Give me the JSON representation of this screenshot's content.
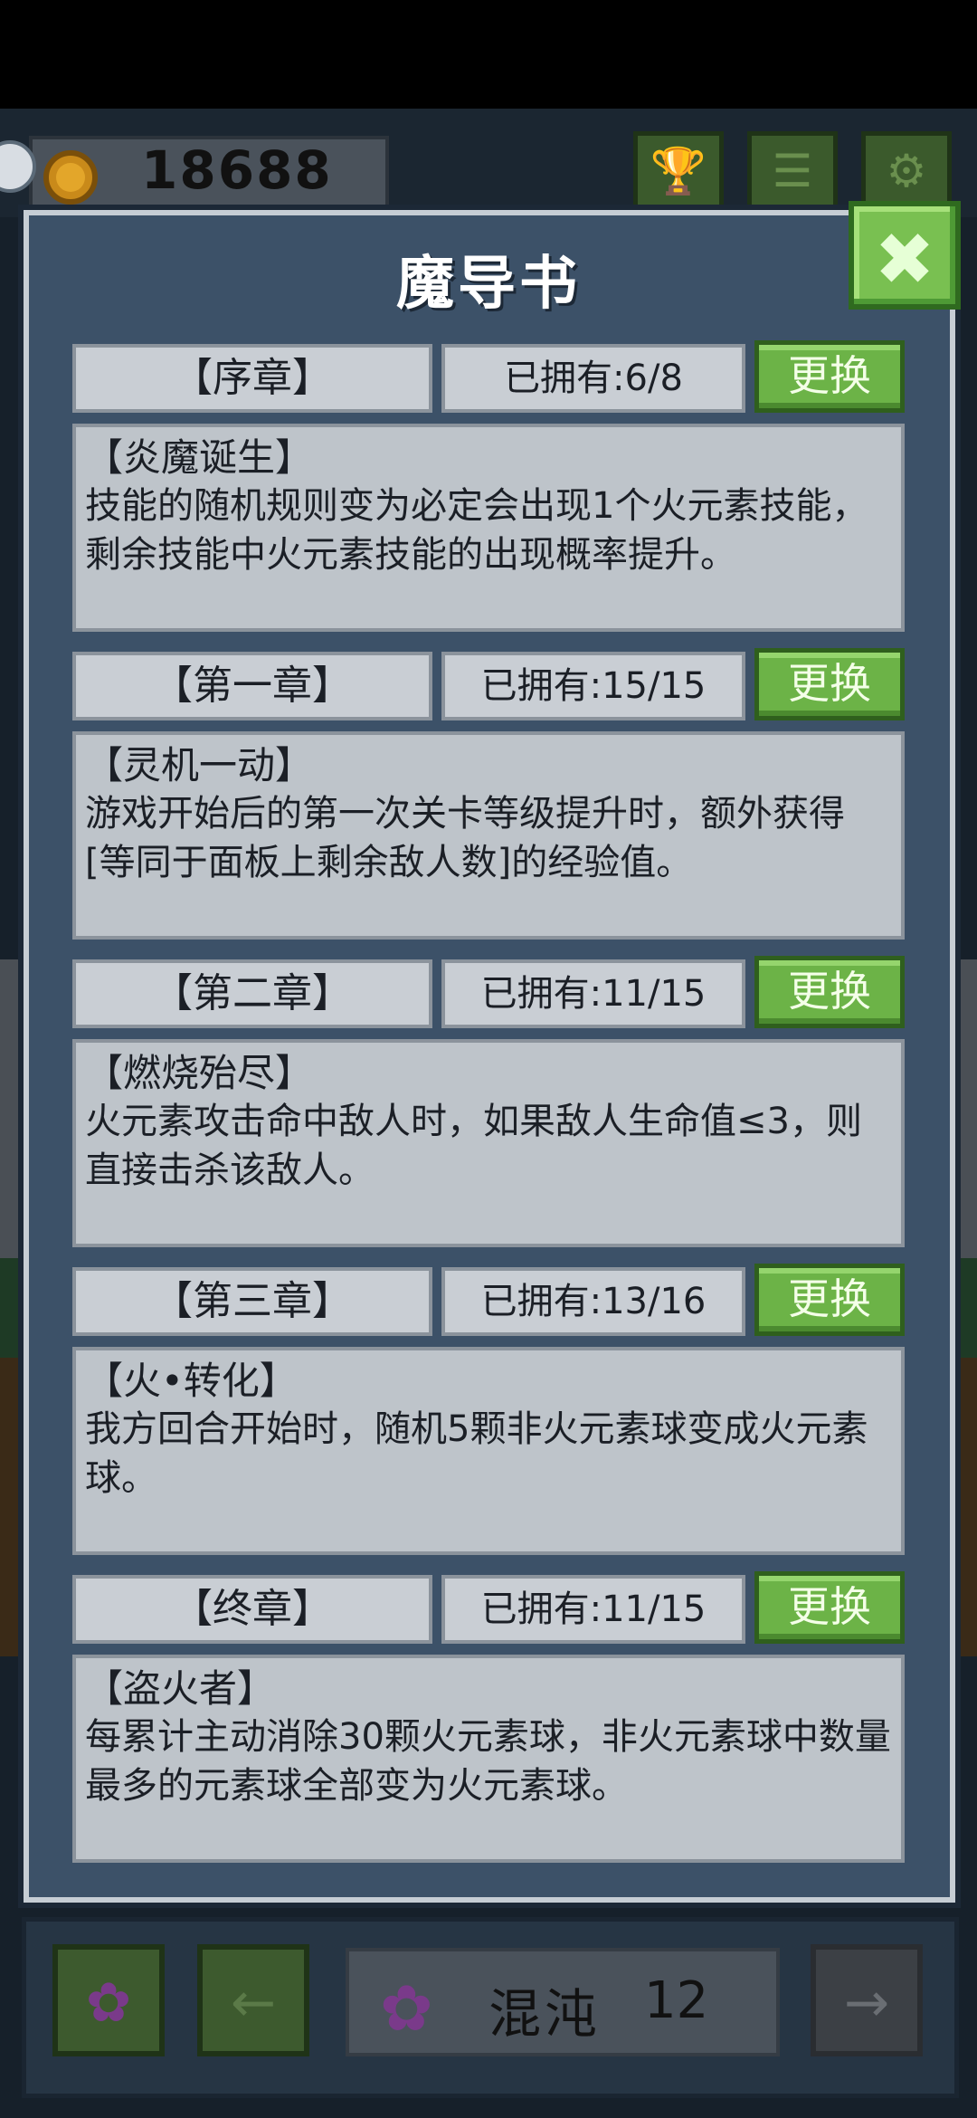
{
  "hud": {
    "coins": "18688",
    "buttons": [
      {
        "icon": "trophy-icon",
        "glyph": "🏆"
      },
      {
        "icon": "list-icon",
        "glyph": "☰"
      },
      {
        "icon": "gear-icon",
        "glyph": "⚙"
      }
    ]
  },
  "dialog": {
    "title": "魔导书",
    "close_glyph": "✖",
    "chapters": [
      {
        "label": "【序章】",
        "owned": "已拥有:6/8",
        "change": "更换",
        "skill_name": "【炎魔诞生】",
        "skill_desc": "技能的随机规则变为必定会出现1个火元素技能，剩余技能中火元素技能的出现概率提升。"
      },
      {
        "label": "【第一章】",
        "owned": "已拥有:15/15",
        "change": "更换",
        "skill_name": "【灵机一动】",
        "skill_desc": "游戏开始后的第一次关卡等级提升时，额外获得[等同于面板上剩余敌人数]的经验值。"
      },
      {
        "label": "【第二章】",
        "owned": "已拥有:11/15",
        "change": "更换",
        "skill_name": "【燃烧殆尽】",
        "skill_desc": "火元素攻击命中敌人时，如果敌人生命值≤3，则直接击杀该敌人。"
      },
      {
        "label": "【第三章】",
        "owned": "已拥有:13/16",
        "change": "更换",
        "skill_name": "【火•转化】",
        "skill_desc": "我方回合开始时，随机5颗非火元素球变成火元素球。"
      },
      {
        "label": "【终章】",
        "owned": "已拥有:11/15",
        "change": "更换",
        "skill_name": "【盗火者】",
        "skill_desc": "每累计主动消除30颗火元素球，非火元素球中数量最多的元素球全部变为火元素球。"
      }
    ]
  },
  "bottom": {
    "element_name": "混沌",
    "element_level": "12",
    "flower_glyph": "✿",
    "left_arrow": "←",
    "right_arrow": "→"
  },
  "colors": {
    "panel": "#3c5168",
    "button_green": "#6cb347",
    "card": "#bec4ca"
  }
}
